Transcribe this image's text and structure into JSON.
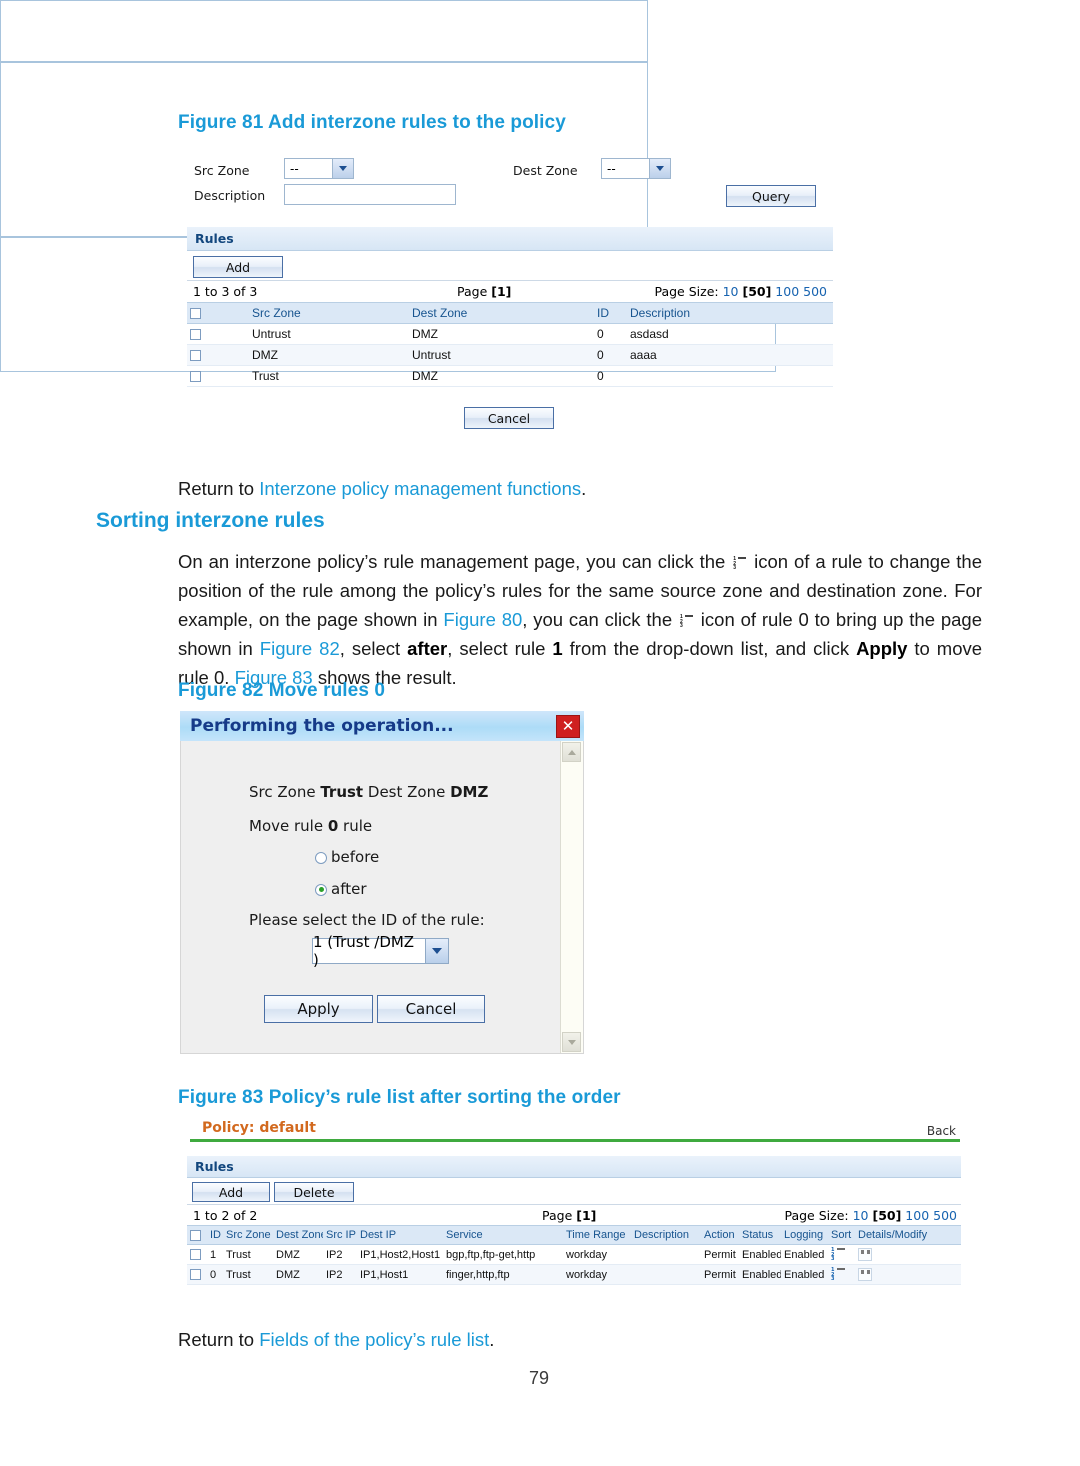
{
  "page": {
    "number": "79"
  },
  "figure81": {
    "caption": "Figure 81 Add interzone rules to the policy",
    "query_form": {
      "src_zone_label": "Src Zone",
      "src_zone_value": "--",
      "dest_zone_label": "Dest Zone",
      "dest_zone_value": "--",
      "description_label": "Description",
      "description_value": "",
      "query_button": "Query"
    },
    "rules_panel": {
      "title": "Rules",
      "add_button": "Add",
      "pager": {
        "count_text": "1 to 3 of 3",
        "page_label": "Page",
        "page_current": "[1]",
        "page_size_label": "Page Size:",
        "sizes": [
          "10",
          "50",
          "100",
          "500"
        ],
        "size_selected": "50"
      },
      "columns": [
        "",
        "Src Zone",
        "Dest Zone",
        "ID",
        "Description"
      ],
      "rows": [
        {
          "src_zone": "Untrust",
          "dest_zone": "DMZ",
          "id": "0",
          "description": "asdasd"
        },
        {
          "src_zone": "DMZ",
          "dest_zone": "Untrust",
          "id": "0",
          "description": "aaaa"
        },
        {
          "src_zone": "Trust",
          "dest_zone": "DMZ",
          "id": "0",
          "description": ""
        }
      ]
    },
    "cancel_button": "Cancel"
  },
  "return_link_1": {
    "prefix": "Return to ",
    "link": "Interzone policy management functions",
    "suffix": "."
  },
  "section": {
    "heading": "Sorting interzone rules",
    "paragraph": {
      "p1": "On an interzone policy’s rule management page, you can click the ",
      "p2": " icon of a rule to change the position of the rule among the policy’s rules for the same source zone and destination zone. For example, on the page shown in ",
      "fig80": "Figure 80",
      "p3": ", you can click the ",
      "p4": " icon of rule 0 to bring up the page shown in ",
      "fig82": "Figure 82",
      "p5": ", select ",
      "after_bold": "after",
      "p6": ", select rule ",
      "one_bold": "1",
      "p7": " from the drop-down list, and click ",
      "apply_bold": "Apply",
      "p8": " to move rule 0. ",
      "fig83": "Figure 83",
      "p9": " shows the result."
    }
  },
  "figure82": {
    "caption": "Figure 82 Move rules 0",
    "dialog": {
      "title": "Performing the operation...",
      "close_icon": "✕",
      "src_zone_label": "Src Zone",
      "src_zone_value": "Trust",
      "dest_zone_label": "Dest Zone",
      "dest_zone_value": "DMZ",
      "move_prefix": "Move rule ",
      "move_rule_id": "0",
      "move_suffix": " rule",
      "radio_before": "before",
      "radio_after": "after",
      "radio_selected": "after",
      "select_prompt": "Please select the ID of the rule:",
      "select_value": "1 (Trust /DMZ )",
      "apply_button": "Apply",
      "cancel_button": "Cancel"
    }
  },
  "figure83": {
    "caption": "Figure 83 Policy’s rule list after sorting the order",
    "policy_bar": {
      "label": "Policy:",
      "value": "default",
      "back_link": "Back"
    },
    "rules_panel": {
      "title": "Rules",
      "add_button": "Add",
      "delete_button": "Delete",
      "pager": {
        "count_text": "1 to 2 of 2",
        "page_label": "Page",
        "page_current": "[1]",
        "page_size_label": "Page Size:",
        "sizes": [
          "10",
          "50",
          "100",
          "500"
        ],
        "size_selected": "50"
      },
      "columns": [
        "",
        "ID",
        "Src Zone",
        "Dest Zone",
        "Src IP",
        "Dest IP",
        "Service",
        "Time Range",
        "Description",
        "Action",
        "Status",
        "Logging",
        "Sort",
        "Details/Modify"
      ],
      "rows": [
        {
          "id": "1",
          "src_zone": "Trust",
          "dest_zone": "DMZ",
          "src_ip": "IP2",
          "dest_ip": "IP1,Host2,Host1",
          "service": "bgp,ftp,ftp-get,http",
          "time_range": "workday",
          "description": "",
          "action": "Permit",
          "status": "Enabled",
          "logging": "Enabled"
        },
        {
          "id": "0",
          "src_zone": "Trust",
          "dest_zone": "DMZ",
          "src_ip": "IP2",
          "dest_ip": "IP1,Host1",
          "service": "finger,http,ftp",
          "time_range": "workday",
          "description": "",
          "action": "Permit",
          "status": "Enabled",
          "logging": "Enabled"
        }
      ]
    }
  },
  "return_link_2": {
    "prefix": "Return to ",
    "link": "Fields of the policy’s rule list",
    "suffix": "."
  },
  "colors": {
    "heading_blue": "#1a9ad7",
    "link_blue": "#1a9ad7",
    "policy_orange": "#d2691e",
    "policy_underline_green": "#3faa3f",
    "grid_header_bg": "#dbe8f6",
    "close_red": "#cf1f1f"
  }
}
